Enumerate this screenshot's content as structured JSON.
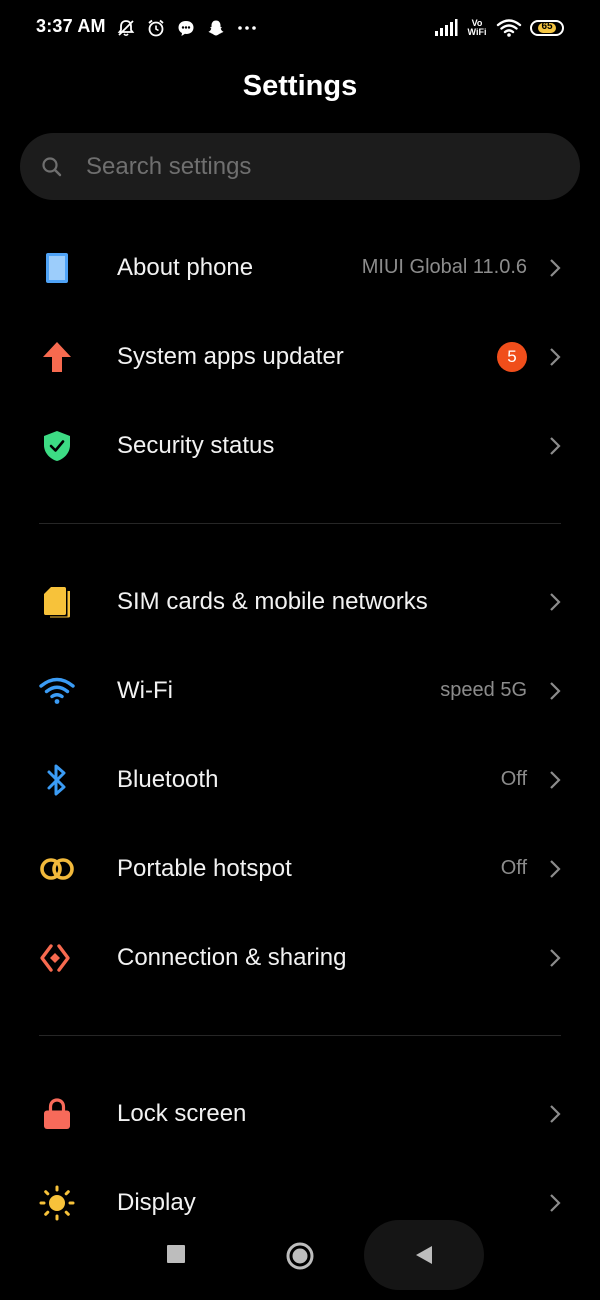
{
  "status_bar": {
    "time": "3:37 AM",
    "left_icons": [
      "muted-bell-icon",
      "alarm-icon",
      "chat-bubble-icon",
      "snapchat-icon",
      "more-dots-icon"
    ],
    "vowifi_line1": "Vo",
    "vowifi_line2": "WiFi",
    "battery_level": "65",
    "battery_color": "#f4c542"
  },
  "header": {
    "title": "Settings"
  },
  "search": {
    "placeholder": "Search settings"
  },
  "sections": [
    {
      "items": [
        {
          "label": "About phone",
          "value": "MIUI Global 11.0.6",
          "icon": "phone-icon",
          "icon_color": "#4fa3f7"
        },
        {
          "label": "System apps updater",
          "badge": "5",
          "icon": "arrow-up-icon",
          "icon_color": "#f76a4f"
        },
        {
          "label": "Security status",
          "icon": "shield-check-icon",
          "icon_color": "#3ddc84"
        }
      ]
    },
    {
      "items": [
        {
          "label": "SIM cards & mobile networks",
          "icon": "sim-card-icon",
          "icon_color": "#f7c23a"
        },
        {
          "label": "Wi-Fi",
          "value": "speed 5G",
          "icon": "wifi-icon",
          "icon_color": "#3b9cf5"
        },
        {
          "label": "Bluetooth",
          "value": "Off",
          "icon": "bluetooth-icon",
          "icon_color": "#3b9cf5"
        },
        {
          "label": "Portable hotspot",
          "value": "Off",
          "icon": "hotspot-icon",
          "icon_color": "#f2b93b"
        },
        {
          "label": "Connection & sharing",
          "icon": "connection-sharing-icon",
          "icon_color": "#f76a4f"
        }
      ]
    },
    {
      "items": [
        {
          "label": "Lock screen",
          "icon": "lock-icon",
          "icon_color": "#f76a5a"
        },
        {
          "label": "Display",
          "icon": "sun-icon",
          "icon_color": "#f7c23a"
        }
      ]
    }
  ],
  "nav_bar": {
    "buttons": [
      "recents-button",
      "home-button",
      "back-button"
    ]
  }
}
